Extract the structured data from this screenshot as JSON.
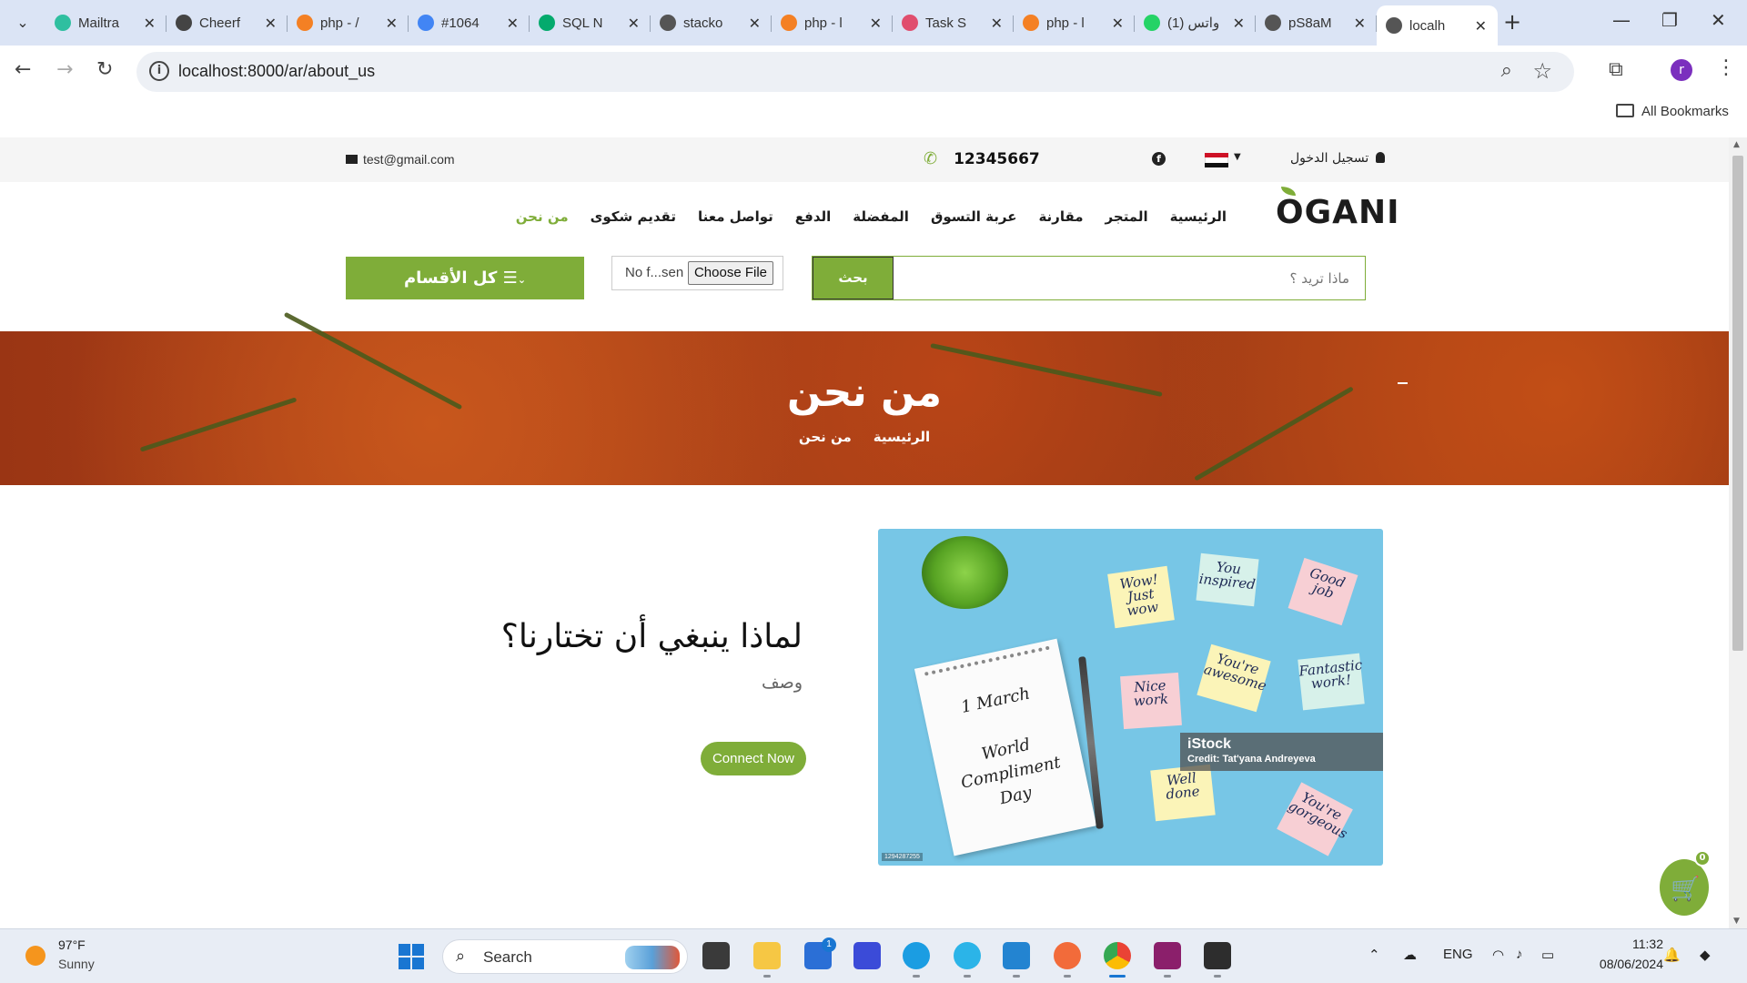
{
  "browser": {
    "tabs": [
      {
        "title": "Mailtra",
        "fav_color": "#2fbfa0"
      },
      {
        "title": "Cheerf",
        "fav_color": "#444444"
      },
      {
        "title": "php - /",
        "fav_color": "#f48024"
      },
      {
        "title": "#1064",
        "fav_color": "#4285f4"
      },
      {
        "title": "SQL N",
        "fav_color": "#04aa6d"
      },
      {
        "title": "stacko",
        "fav_color": "#555555"
      },
      {
        "title": "php - l",
        "fav_color": "#f48024"
      },
      {
        "title": "Task S",
        "fav_color": "#e04e6e"
      },
      {
        "title": "php - l",
        "fav_color": "#f48024"
      },
      {
        "title": "(1) واتس",
        "fav_color": "#25d366"
      },
      {
        "title": "pS8aM",
        "fav_color": "#555555"
      },
      {
        "title": "localh",
        "fav_color": "#555555"
      }
    ],
    "url": "localhost:8000/ar/about_us",
    "bookmarks_label": "All Bookmarks",
    "profile_initial": "r"
  },
  "topbar": {
    "email": "test@gmail.com",
    "phone": "12345667",
    "login": "تسجيل الدخول"
  },
  "header": {
    "logo": "OGANI",
    "nav": [
      {
        "label": "الرئيسية",
        "active": false
      },
      {
        "label": "المتجر",
        "active": false
      },
      {
        "label": "مقارنة",
        "active": false
      },
      {
        "label": "عربة التسوق",
        "active": false
      },
      {
        "label": "المفضلة",
        "active": false
      },
      {
        "label": "الدفع",
        "active": false
      },
      {
        "label": "تواصل معنا",
        "active": false
      },
      {
        "label": "تقديم شكوى",
        "active": false
      },
      {
        "label": "من نحن",
        "active": true
      }
    ],
    "categories_label": "كل الأقسام",
    "file_no_file": "No f...sen",
    "file_button": "Choose File",
    "search_placeholder": "ماذا تريد ؟",
    "search_button": "بحث"
  },
  "hero": {
    "title": "من نحن",
    "crumb_home": "الرئيسية",
    "crumb_current": "من نحن"
  },
  "about": {
    "heading": "لماذا ينبغي أن تختارنا؟",
    "description": "وصف",
    "button": "Connect Now"
  },
  "photo": {
    "notebook_line1": "1 March",
    "notebook_line2": "World",
    "notebook_line3": "Compliment",
    "notebook_line4": "Day",
    "notes": [
      "Wow! Just wow",
      "You inspired",
      "Good job",
      "Nice work",
      "You're awesome",
      "Fantastic work!",
      "Well done",
      "You're gorgeous"
    ],
    "watermark": "iStock",
    "credit": "Credit: Tat'yana Andreyeva",
    "image_id": "1294287255"
  },
  "cart": {
    "count": "0"
  },
  "taskbar": {
    "temperature": "97°F",
    "condition": "Sunny",
    "search_label": "Search",
    "store_badge": "1",
    "language": "ENG",
    "time": "11:32",
    "date": "08/06/2024"
  },
  "colors": {
    "accent": "#7fad39"
  }
}
